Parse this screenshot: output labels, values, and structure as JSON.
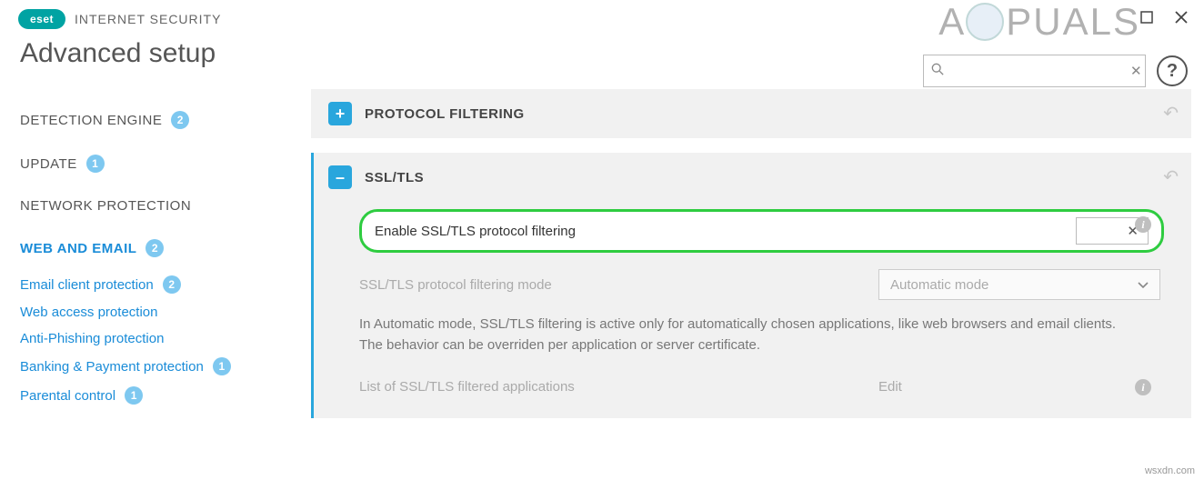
{
  "brand": {
    "logo": "eset",
    "product": "INTERNET SECURITY"
  },
  "watermark": {
    "text": "A   PUALS"
  },
  "source": "wsxdn.com",
  "page_title": "Advanced setup",
  "search": {
    "value": "",
    "placeholder": ""
  },
  "sidebar": {
    "items": [
      {
        "label": "DETECTION ENGINE",
        "badge": "2",
        "active": false
      },
      {
        "label": "UPDATE",
        "badge": "1",
        "active": false
      },
      {
        "label": "NETWORK PROTECTION",
        "badge": "",
        "active": false
      },
      {
        "label": "WEB AND EMAIL",
        "badge": "2",
        "active": true
      }
    ],
    "subitems": [
      {
        "label": "Email client protection",
        "badge": "2"
      },
      {
        "label": "Web access protection",
        "badge": ""
      },
      {
        "label": "Anti-Phishing protection",
        "badge": ""
      },
      {
        "label": "Banking & Payment protection",
        "badge": "1"
      },
      {
        "label": "Parental control",
        "badge": "1"
      }
    ]
  },
  "sections": {
    "protocol": {
      "title": "PROTOCOL FILTERING"
    },
    "ssl": {
      "title": "SSL/TLS",
      "enable_label": "Enable SSL/TLS protocol filtering",
      "toggle_symbol": "✕",
      "mode_label": "SSL/TLS protocol filtering mode",
      "mode_value": "Automatic mode",
      "description": "In Automatic mode, SSL/TLS filtering is active only for automatically chosen applications, like web browsers and email clients. The behavior can be overriden per application or server certificate.",
      "list_label": "List of SSL/TLS filtered applications",
      "list_action": "Edit"
    }
  }
}
